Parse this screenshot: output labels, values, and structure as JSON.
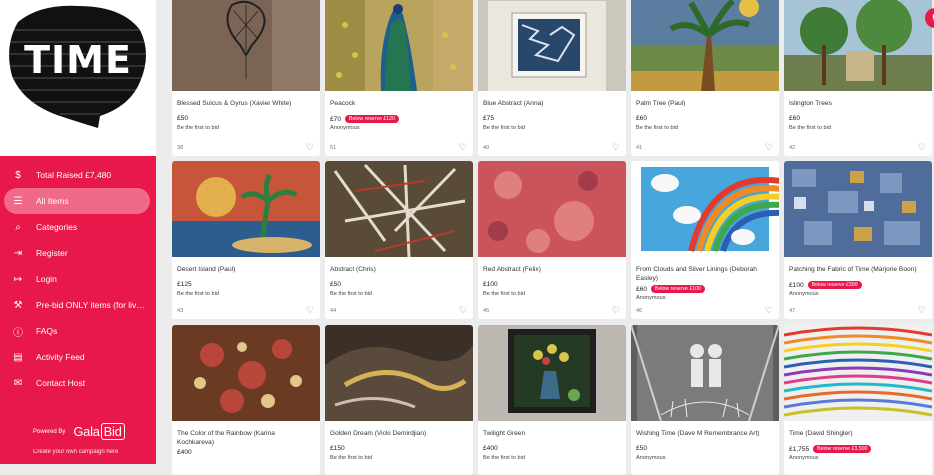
{
  "logo": {
    "word": "TIME"
  },
  "sidebar": {
    "items": [
      {
        "icon": "dollar-icon",
        "glyph": "$",
        "label": "Total Raised £7,480"
      },
      {
        "icon": "list-icon",
        "glyph": "☰",
        "label": "All Items",
        "active": true
      },
      {
        "icon": "search-icon",
        "glyph": "⌕",
        "label": "Categories"
      },
      {
        "icon": "register-icon",
        "glyph": "⇥",
        "label": "Register"
      },
      {
        "icon": "login-icon",
        "glyph": "↦",
        "label": "Login"
      },
      {
        "icon": "gavel-icon",
        "glyph": "⚒",
        "label": "Pre-bid ONLY items (for live ..."
      },
      {
        "icon": "info-icon",
        "glyph": "ⓘ",
        "label": "FAQs"
      },
      {
        "icon": "feed-icon",
        "glyph": "▤",
        "label": "Activity Feed"
      },
      {
        "icon": "mail-icon",
        "glyph": "✉",
        "label": "Contact Host"
      }
    ],
    "powered_by": "Powered By",
    "brand": "Gala",
    "brand_box": "Bid",
    "create_link": "Create your own campaign here"
  },
  "colors": {
    "accent": "#e8194a"
  },
  "items": [
    {
      "title": "Blessed Sulcus & Gyrus (Xavier White)",
      "price": "£50",
      "badge": "",
      "status": "Be the first to bid",
      "num": "38"
    },
    {
      "title": "Peacock",
      "price": "£70",
      "badge": "Below reserve £120",
      "status": "Anonymous",
      "num": "51"
    },
    {
      "title": "Blue Abstract (Anna)",
      "price": "£75",
      "badge": "",
      "status": "Be the first to bid",
      "num": "40"
    },
    {
      "title": "Palm Tree (Paul)",
      "price": "£60",
      "badge": "",
      "status": "Be the first to bid",
      "num": "41"
    },
    {
      "title": "Islington Trees",
      "price": "£60",
      "badge": "",
      "status": "Be the first to bid",
      "num": "42"
    },
    {
      "title": "Desert Island (Paul)",
      "price": "£125",
      "badge": "",
      "status": "Be the first to bid",
      "num": "43"
    },
    {
      "title": "Abstract (Chris)",
      "price": "£50",
      "badge": "",
      "status": "Be the first to bid",
      "num": "44"
    },
    {
      "title": "Red Abstract (Felix)",
      "price": "£100",
      "badge": "",
      "status": "Be the first to bid",
      "num": "45"
    },
    {
      "title": "From Clouds and Silver Linings (Deborah Easley)",
      "price": "£60",
      "badge": "Below reserve £100",
      "status": "Anonymous",
      "num": "46"
    },
    {
      "title": "Patching the Fabric of Time (Marjorie Boon)",
      "price": "£100",
      "badge": "Below reserve £300",
      "status": "Anonymous",
      "num": "47"
    },
    {
      "title": "The Color of the Rainbow (Karina Kochkareva)",
      "price": "£400",
      "badge": "",
      "status": "",
      "num": ""
    },
    {
      "title": "Golden Dream (Vicki Demirdjian)",
      "price": "£150",
      "badge": "",
      "status": "Be the first to bid",
      "num": ""
    },
    {
      "title": "Twilight Green",
      "price": "£400",
      "badge": "",
      "status": "Be the first to bid",
      "num": ""
    },
    {
      "title": "Wishing Time (Dave M Remembrance Art)",
      "price": "£50",
      "badge": "",
      "status": "Anonymous",
      "num": ""
    },
    {
      "title": "Time (David Shingler)",
      "price": "£1,755",
      "badge": "Below reserve £3,500",
      "status": "Anonymous",
      "num": ""
    }
  ]
}
